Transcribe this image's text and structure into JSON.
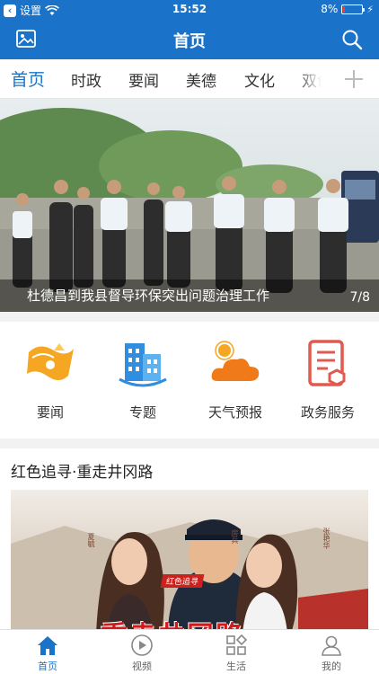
{
  "status_bar": {
    "back_app": "设置",
    "time": "15:52",
    "battery": "8%",
    "battery_level": 0.08
  },
  "nav": {
    "title": "首页"
  },
  "tabs": [
    "首页",
    "时政",
    "要闻",
    "美德",
    "文化",
    "双创"
  ],
  "banner": {
    "caption": "杜德昌到我县督导环保突出问题治理工作",
    "counter": "7/8"
  },
  "services": [
    {
      "label": "要闻",
      "icon": "news-flag-icon"
    },
    {
      "label": "专题",
      "icon": "buildings-icon"
    },
    {
      "label": "天气预报",
      "icon": "weather-icon"
    },
    {
      "label": "政务服务",
      "icon": "document-icon"
    }
  ],
  "section": {
    "heading": "红色追寻·重走井冈路",
    "poster_badge": "红色追寻",
    "poster_title": "重走井冈路",
    "poster_names": [
      "夏毓",
      "房兵",
      "张艳华"
    ]
  },
  "tabbar": [
    {
      "label": "首页",
      "icon": "home-icon",
      "active": true
    },
    {
      "label": "视频",
      "icon": "play-icon",
      "active": false
    },
    {
      "label": "生活",
      "icon": "grid-icon",
      "active": false
    },
    {
      "label": "我的",
      "icon": "user-icon",
      "active": false
    }
  ],
  "colors": {
    "brand": "#1a73c8",
    "news_icon": "#f5a623",
    "weather_icon": "#f07a1a",
    "service_icon": "#e05a4f"
  }
}
